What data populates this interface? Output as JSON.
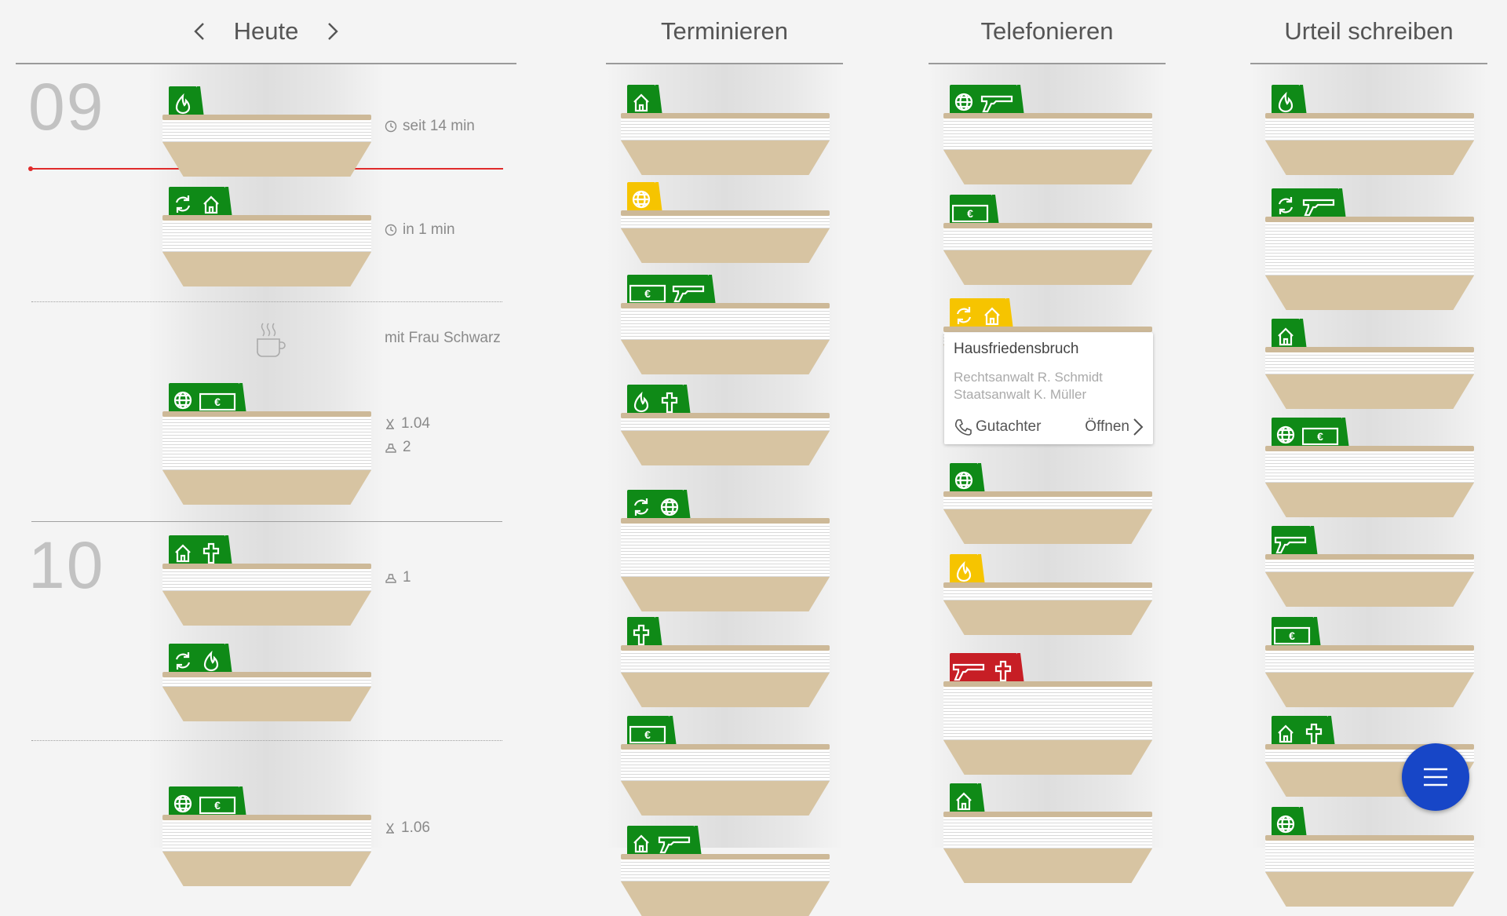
{
  "columns": {
    "today": {
      "title": "Heute"
    },
    "terminieren": {
      "title": "Terminieren"
    },
    "telefonieren": {
      "title": "Telefonieren"
    },
    "urteil": {
      "title": "Urteil schreiben"
    }
  },
  "timeline": {
    "hours": [
      "09",
      "10"
    ],
    "tray_info": {
      "t1": "seit 14 min",
      "t2": "in 1 min",
      "t3a": "1.04",
      "t3b": "2",
      "t4": "1",
      "t6": "1.06"
    },
    "break_label": "mit Frau Schwarz"
  },
  "popup": {
    "title": "Hausfriedensbruch",
    "line1": "Rechtsanwalt R. Schmidt",
    "line2": "Staatsanwalt K. Müller",
    "call_label": "Gutachter",
    "open_label": "Öffnen"
  },
  "icons": {
    "fire": "fire-icon",
    "house": "house-icon",
    "cycle": "cycle-icon",
    "globe": "globe-icon",
    "euro": "euro-banknote-icon",
    "gun": "gun-icon",
    "cross": "cross-icon",
    "clock": "clock-icon",
    "person": "person-icon",
    "lawyer": "lawyer-icon",
    "cup": "coffee-cup-icon",
    "phone": "phone-icon",
    "menu": "menu-icon"
  },
  "colors": {
    "green": "#0f8a17",
    "yellow": "#f6c400",
    "red": "#c71e25",
    "now_line": "#e02b2b",
    "fab": "#1746c7"
  }
}
